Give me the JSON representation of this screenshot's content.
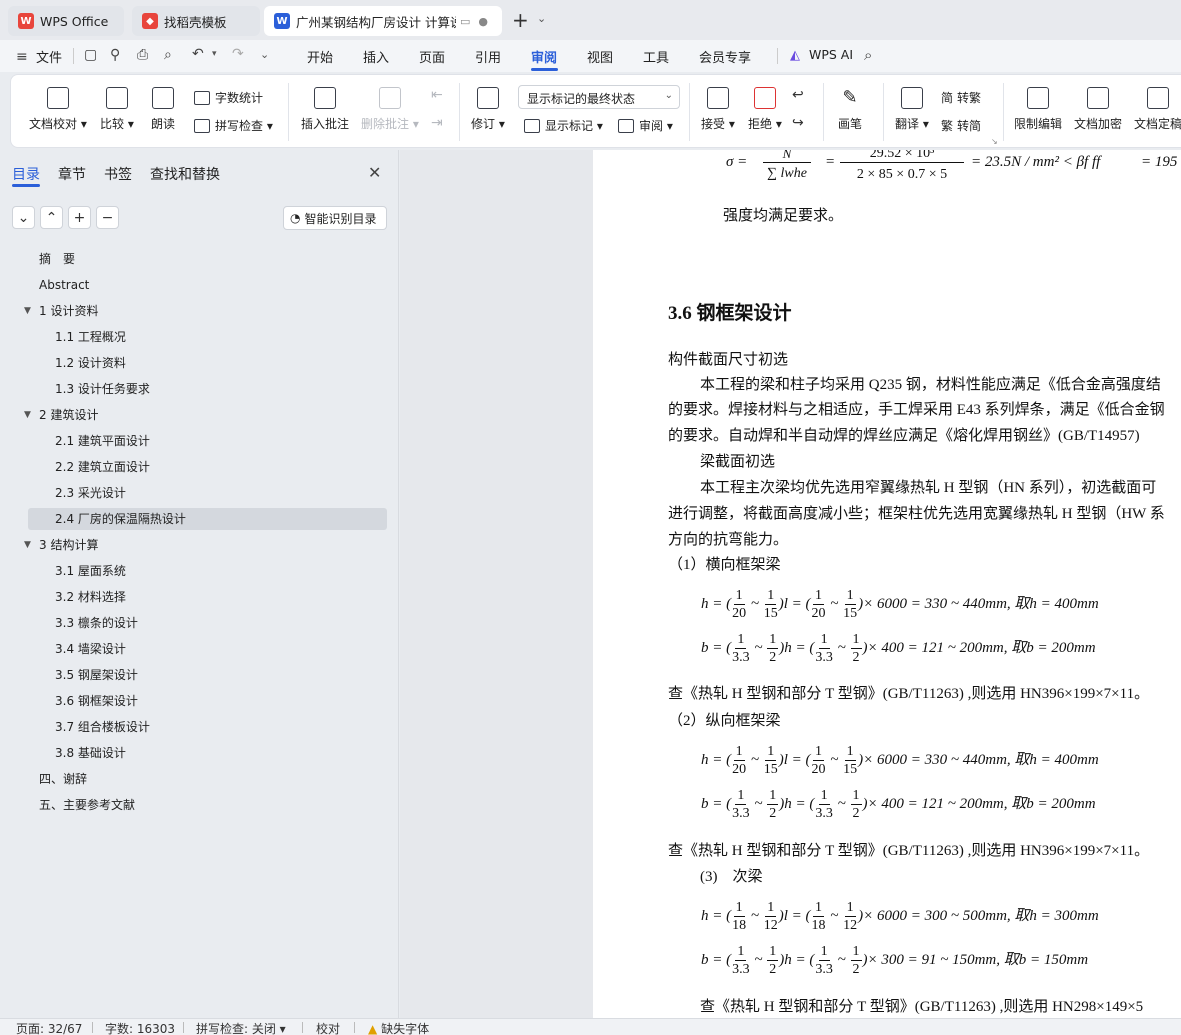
{
  "tabs": [
    {
      "label": "WPS Office",
      "icon": "wps-logo-icon"
    },
    {
      "label": "找稻壳模板",
      "icon": "docer-icon"
    },
    {
      "label": "广州某钢结构厂房设计 计算说",
      "icon": "writer-doc-icon"
    }
  ],
  "menu": {
    "file": "文件",
    "items": [
      "开始",
      "插入",
      "页面",
      "引用",
      "审阅",
      "视图",
      "工具",
      "会员专享"
    ],
    "active": "审阅",
    "ai": "WPS AI"
  },
  "ribbon": {
    "proofread": "文档校对",
    "compare": "比较",
    "read_aloud": "朗读",
    "word_count": "字数统计",
    "spell_check": "拼写检查",
    "insert_comment": "插入批注",
    "delete_comment": "删除批注",
    "revise": "修订",
    "markup_state": "显示标记的最终状态",
    "show_markup": "显示标记",
    "review": "审阅",
    "accept": "接受",
    "reject": "拒绝",
    "pen": "画笔",
    "translate": "翻译",
    "to_traditional": "转繁",
    "to_simplified": "转简",
    "restrict_edit": "限制编辑",
    "encrypt": "文档加密",
    "finalize": "文档定稿"
  },
  "sidebar": {
    "tabs": [
      "目录",
      "章节",
      "书签",
      "查找和替换"
    ],
    "active_tab": "目录",
    "smart_toc": "智能识别目录",
    "items": [
      {
        "label": "摘　要",
        "level": 0,
        "expand": false
      },
      {
        "label": "Abstract",
        "level": 0,
        "expand": false
      },
      {
        "label": "1 设计资料",
        "level": 0,
        "expand": true
      },
      {
        "label": "1.1 工程概况",
        "level": 1,
        "expand": false
      },
      {
        "label": "1.2 设计资料",
        "level": 1,
        "expand": false
      },
      {
        "label": "1.3 设计任务要求",
        "level": 1,
        "expand": false
      },
      {
        "label": "2 建筑设计",
        "level": 0,
        "expand": true
      },
      {
        "label": "2.1 建筑平面设计",
        "level": 1,
        "expand": false
      },
      {
        "label": "2.2 建筑立面设计",
        "level": 1,
        "expand": false
      },
      {
        "label": "2.3  采光设计",
        "level": 1,
        "expand": false
      },
      {
        "label": "2.4  厂房的保温隔热设计",
        "level": 1,
        "expand": false,
        "selected": true
      },
      {
        "label": "3 结构计算",
        "level": 0,
        "expand": true
      },
      {
        "label": "3.1 屋面系统",
        "level": 1,
        "expand": false
      },
      {
        "label": "3.2 材料选择",
        "level": 1,
        "expand": false
      },
      {
        "label": "3.3 檩条的设计",
        "level": 1,
        "expand": false
      },
      {
        "label": "3.4  墙梁设计",
        "level": 1,
        "expand": false
      },
      {
        "label": "3.5  钢屋架设计",
        "level": 1,
        "expand": false
      },
      {
        "label": "3.6 钢框架设计",
        "level": 1,
        "expand": false
      },
      {
        "label": "3.7 组合楼板设计",
        "level": 1,
        "expand": false
      },
      {
        "label": "3.8 基础设计",
        "level": 1,
        "expand": false
      },
      {
        "label": "四、谢辞",
        "level": 0,
        "expand": false
      },
      {
        "label": "五、主要参考文献",
        "level": 0,
        "expand": false
      }
    ]
  },
  "document": {
    "formula_top": {
      "sigma": "σ =",
      "num1": "N",
      "den1": "∑ lwhe",
      "num2": "29.52 × 10³",
      "den2": "2 × 85 × 0.7 × 5",
      "result": "= 23.5N / mm² < βf ff",
      "tail": "= 195"
    },
    "ok_text": "强度均满足要求。",
    "heading": "3.6 钢框架设计",
    "p1": "构件截面尺寸初选",
    "p2": "本工程的梁和柱子均采用 Q235 钢，材料性能应满足《低合金高强度结",
    "p3": "的要求。焊接材料与之相适应，手工焊采用 E43 系列焊条，满足《低合金钢",
    "p4": "的要求。自动焊和半自动焊的焊丝应满足《熔化焊用钢丝》(GB/T14957)",
    "p5": "梁截面初选",
    "p6": "本工程主次梁均优先选用窄翼缘热轧 H 型钢（HN 系列），初选截面可",
    "p7": "进行调整，将截面高度减小些；框架柱优先选用宽翼缘热轧 H 型钢（HW 系",
    "p8": "方向的抗弯能力。",
    "s1": "（1）横向框架梁",
    "f1a": {
      "lhs": "h = (",
      "a": "1",
      "b": "20",
      "c": "1",
      "d": "15",
      "mid": ")l = (",
      "e": "1",
      "f": "20",
      "g": "1",
      "h": "15",
      "rhs": ")× 6000 = 330 ~ 440mm, 取h = 400mm"
    },
    "f1b": {
      "lhs": "b = (",
      "a": "1",
      "b": "3.3",
      "c": "1",
      "d": "2",
      "mid": ")h = (",
      "e": "1",
      "f": "3.3",
      "g": "1",
      "h": "2",
      "rhs": ")× 400 = 121 ~ 200mm, 取b = 200mm"
    },
    "q1": "查《热轧 H 型钢和部分 T 型钢》(GB/T11263) ,则选用 HN396×199×7×11。",
    "s2": "（2）纵向框架梁",
    "f2a": {
      "lhs": "h = (",
      "a": "1",
      "b": "20",
      "c": "1",
      "d": "15",
      "mid": ")l = (",
      "e": "1",
      "f": "20",
      "g": "1",
      "h": "15",
      "rhs": ")× 6000 = 330 ~ 440mm, 取h = 400mm"
    },
    "f2b": {
      "lhs": "b = (",
      "a": "1",
      "b": "3.3",
      "c": "1",
      "d": "2",
      "mid": ")h = (",
      "e": "1",
      "f": "3.3",
      "g": "1",
      "h": "2",
      "rhs": ")× 400 = 121 ~ 200mm, 取b = 200mm"
    },
    "q2": "查《热轧 H 型钢和部分 T 型钢》(GB/T11263) ,则选用 HN396×199×7×11。",
    "s3": "(3)　次梁",
    "f3a": {
      "lhs": "h = (",
      "a": "1",
      "b": "18",
      "c": "1",
      "d": "12",
      "mid": ")l = (",
      "e": "1",
      "f": "18",
      "g": "1",
      "h": "12",
      "rhs": ")× 6000 = 300 ~ 500mm, 取h = 300mm"
    },
    "f3b": {
      "lhs": "b = (",
      "a": "1",
      "b": "3.3",
      "c": "1",
      "d": "2",
      "mid": ")h = (",
      "e": "1",
      "f": "3.3",
      "g": "1",
      "h": "2",
      "rhs": ")× 300 = 91 ~ 150mm, 取b = 150mm"
    },
    "q3": "查《热轧 H 型钢和部分 T 型钢》(GB/T11263) ,则选用 HN298×149×5"
  },
  "status": {
    "page": "页面: 32/67",
    "words": "字数: 16303",
    "spell": "拼写检查: 关闭",
    "proof": "校对",
    "missing_font": "缺失字体"
  },
  "colors": {
    "accent": "#2b5fd9",
    "wps_red": "#e8453c",
    "selected_row": "#d4d8de"
  }
}
